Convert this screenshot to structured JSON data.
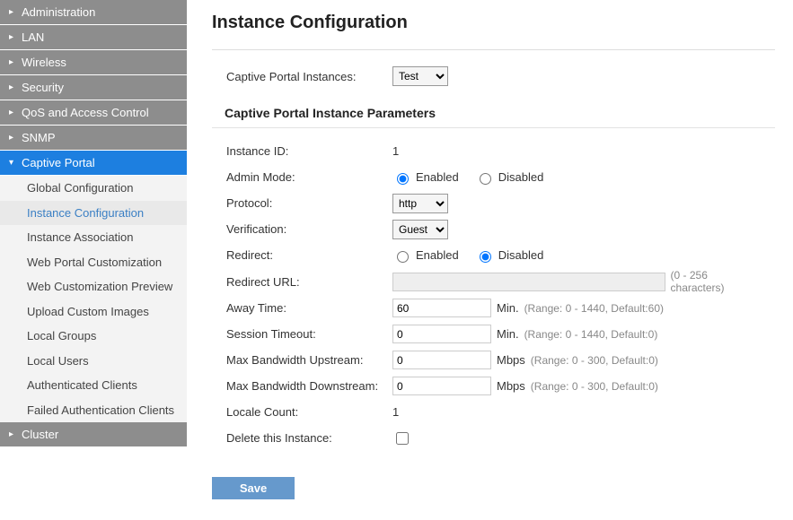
{
  "sidebar": {
    "items": [
      {
        "label": "Administration",
        "expanded": false
      },
      {
        "label": "LAN",
        "expanded": false
      },
      {
        "label": "Wireless",
        "expanded": false
      },
      {
        "label": "Security",
        "expanded": false
      },
      {
        "label": "QoS and Access Control",
        "expanded": false
      },
      {
        "label": "SNMP",
        "expanded": false
      },
      {
        "label": "Captive Portal",
        "expanded": true,
        "active": true,
        "sub": [
          {
            "label": "Global Configuration"
          },
          {
            "label": "Instance Configuration",
            "selected": true
          },
          {
            "label": "Instance Association"
          },
          {
            "label": "Web Portal Customization"
          },
          {
            "label": "Web Customization Preview"
          },
          {
            "label": "Upload Custom Images"
          },
          {
            "label": "Local Groups"
          },
          {
            "label": "Local Users"
          },
          {
            "label": "Authenticated Clients"
          },
          {
            "label": "Failed Authentication Clients"
          }
        ]
      },
      {
        "label": "Cluster",
        "expanded": false
      }
    ]
  },
  "page": {
    "title": "Instance Configuration",
    "instance_selector_label": "Captive Portal Instances:",
    "instance_selector_value": "Test",
    "params_header": "Captive Portal Instance Parameters",
    "labels": {
      "instance_id": "Instance ID:",
      "admin_mode": "Admin Mode:",
      "protocol": "Protocol:",
      "verification": "Verification:",
      "redirect": "Redirect:",
      "redirect_url": "Redirect URL:",
      "away_time": "Away Time:",
      "session_timeout": "Session Timeout:",
      "mbu": "Max Bandwidth Upstream:",
      "mbd": "Max Bandwidth Downstream:",
      "locale_count": "Locale Count:",
      "delete": "Delete this Instance:"
    },
    "values": {
      "instance_id": "1",
      "admin_mode": "Enabled",
      "protocol": "http",
      "verification": "Guest",
      "redirect": "Disabled",
      "redirect_url": "",
      "away_time": "60",
      "session_timeout": "0",
      "mbu": "0",
      "mbd": "0",
      "locale_count": "1",
      "delete": false
    },
    "radio_options": {
      "enabled": "Enabled",
      "disabled": "Disabled"
    },
    "hints": {
      "redirect_url": "(0 - 256 characters)",
      "away_time_unit": "Min.",
      "away_time_range": "(Range: 0 - 1440, Default:60)",
      "session_unit": "Min.",
      "session_range": "(Range: 0 - 1440, Default:0)",
      "mbu_unit": "Mbps",
      "mbu_range": "(Range: 0 - 300, Default:0)",
      "mbd_unit": "Mbps",
      "mbd_range": "(Range: 0 - 300, Default:0)"
    },
    "save_label": "Save"
  }
}
